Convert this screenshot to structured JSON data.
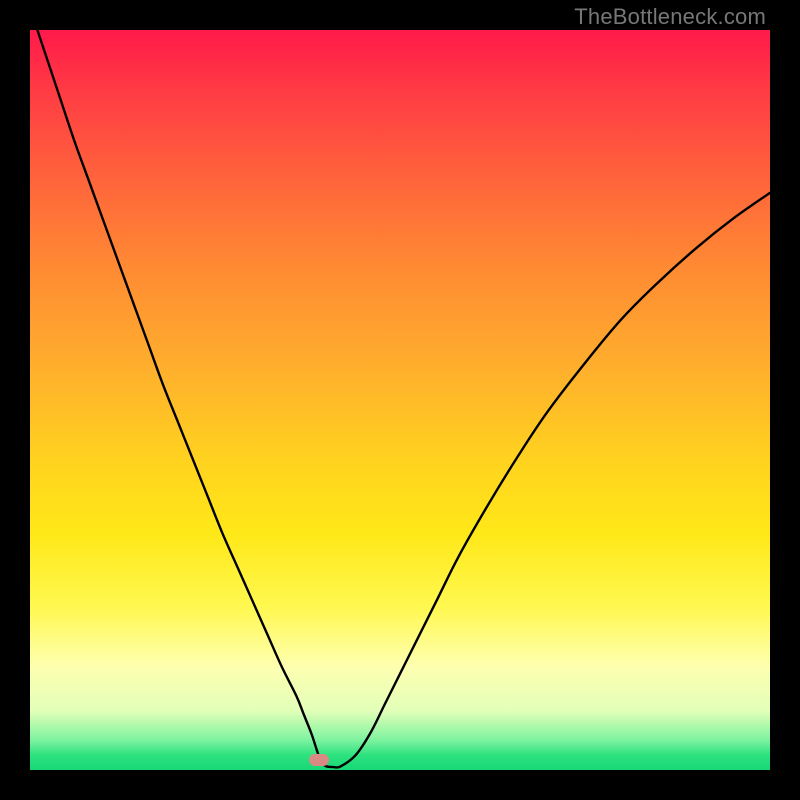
{
  "watermark": "TheBottleneck.com",
  "colors": {
    "frame": "#000000",
    "gradient_top": "#ff1a4a",
    "gradient_bottom": "#17d877",
    "curve": "#000000",
    "marker": "#d98a84"
  },
  "chart_data": {
    "type": "line",
    "title": "",
    "xlabel": "",
    "ylabel": "",
    "xlim": [
      0,
      100
    ],
    "ylim": [
      0,
      100
    ],
    "grid": false,
    "x": [
      0,
      2,
      4,
      6,
      8,
      10,
      12,
      14,
      16,
      18,
      20,
      22,
      24,
      26,
      28,
      30,
      32,
      34,
      36,
      37,
      38,
      38.5,
      39,
      39.5,
      40,
      41,
      42,
      44,
      46,
      48,
      50,
      52,
      55,
      58,
      62,
      66,
      70,
      75,
      80,
      85,
      90,
      95,
      100
    ],
    "values": [
      103,
      97,
      91,
      85,
      79.5,
      74,
      68.5,
      63,
      57.5,
      52,
      47,
      42,
      37,
      32,
      27.5,
      23,
      18.5,
      14,
      10,
      7.5,
      5,
      3.5,
      2,
      1,
      0.5,
      0.4,
      0.5,
      2,
      5,
      9,
      13,
      17,
      23,
      29,
      36,
      42.5,
      48.5,
      55,
      61,
      66,
      70.5,
      74.5,
      78
    ],
    "marker": {
      "x": 39,
      "y": 0.5
    },
    "notes": "V-shaped bottleneck curve; y-axis implied bottleneck percent (0 at bottom, ~100 at top), x-axis implied hardware balance parameter. No explicit tick labels shown."
  }
}
